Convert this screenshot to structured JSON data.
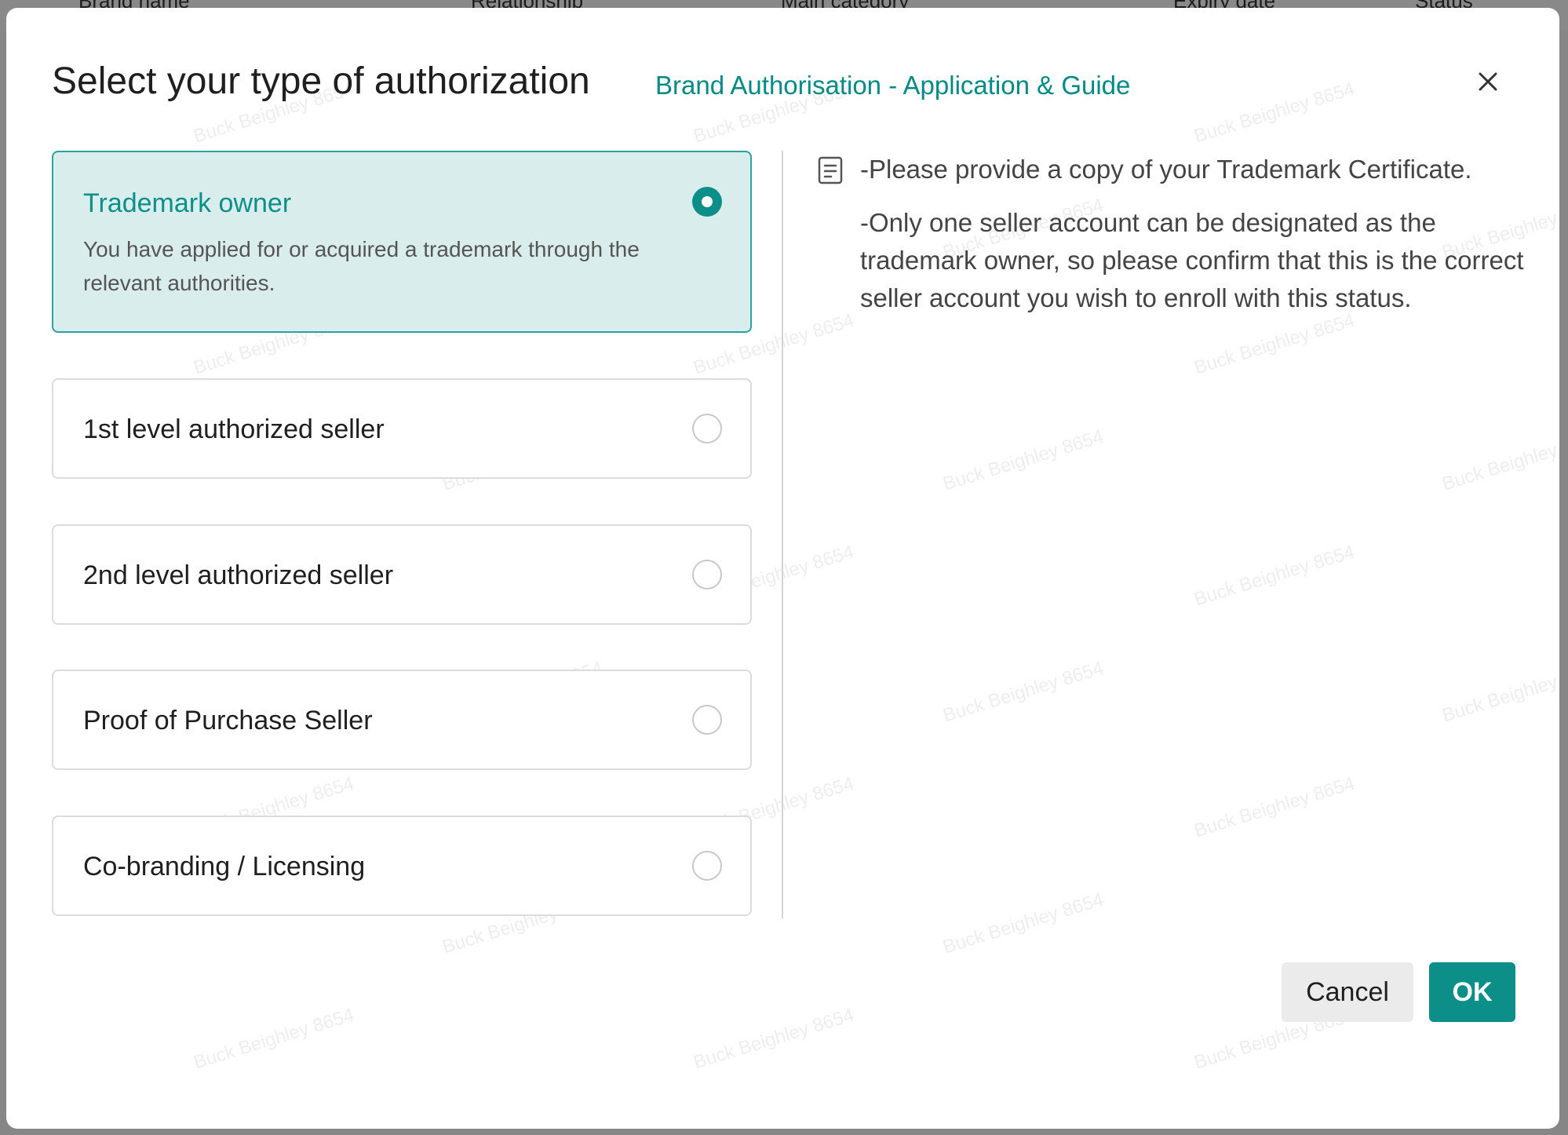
{
  "background_table": {
    "columns": [
      "Brand name",
      "Relationship",
      "Main category",
      "Expiry date",
      "Status"
    ]
  },
  "modal": {
    "title": "Select your type of authorization",
    "guide_link": "Brand Authorisation - Application & Guide",
    "close_icon": "close-icon"
  },
  "options": [
    {
      "label": "Trademark owner",
      "description": "You have applied for or acquired a trademark through the relevant authorities.",
      "selected": true
    },
    {
      "label": "1st level authorized seller",
      "selected": false
    },
    {
      "label": "2nd level authorized seller",
      "selected": false
    },
    {
      "label": "Proof of Purchase Seller",
      "selected": false
    },
    {
      "label": "Co-branding / Licensing",
      "selected": false
    }
  ],
  "info": {
    "icon": "document-icon",
    "line1": "-Please provide a copy of your Trademark Certificate.",
    "line2": "-Only one seller account can be designated as the trademark owner, so please confirm that this is the correct seller account you wish to enroll with this status."
  },
  "buttons": {
    "cancel": "Cancel",
    "ok": "OK"
  },
  "watermark_text": "Buck Beighley 8654",
  "colors": {
    "accent": "#0c8f89",
    "selected_bg": "#d9eeec",
    "selected_border": "#2ba39b"
  }
}
